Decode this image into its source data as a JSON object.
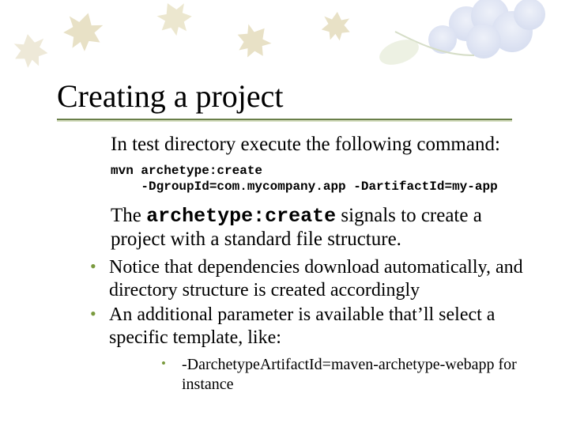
{
  "title": "Creating a project",
  "lead": "In test directory execute the following command:",
  "command": {
    "line1": "mvn archetype:create",
    "line2": "-DgroupId=com.mycompany.app -DartifactId=my-app"
  },
  "explain": {
    "pre": "The ",
    "code": "archetype:create",
    "post": " signals to create a project with a standard file structure."
  },
  "bullets": [
    "Notice that dependencies download automatically, and directory structure is created accordingly",
    "An additional parameter is available that’ll select a specific template, like:"
  ],
  "subbullets": [
    "-DarchetypeArtifactId=maven-archetype-webapp for instance"
  ]
}
